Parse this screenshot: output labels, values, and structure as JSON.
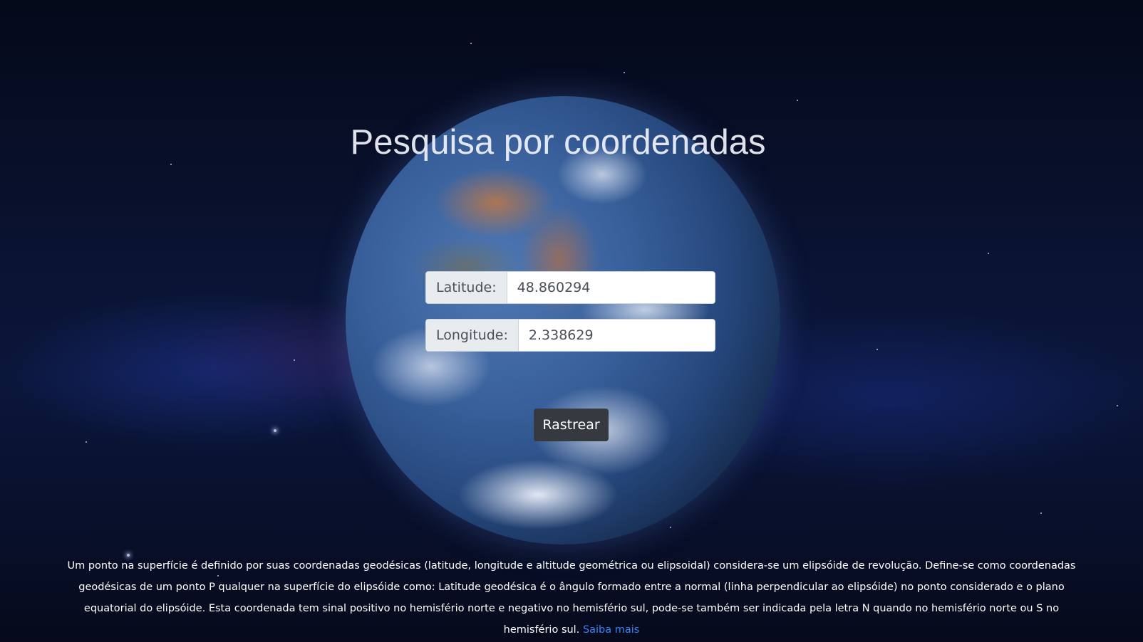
{
  "page": {
    "title": "Pesquisa por coordenadas"
  },
  "form": {
    "latitude": {
      "label": "Latitude:",
      "value": "48.860294"
    },
    "longitude": {
      "label": "Longitude:",
      "value": "2.338629"
    },
    "submit_label": "Rastrear"
  },
  "footer": {
    "description": "Um ponto na superfície é definido por suas coordenadas geodésicas (latitude, longitude e altitude geométrica ou elipsoidal) considera-se um elipsóide de revolução. Define-se como coordenadas geodésicas de um ponto P qualquer na superfície do elipsóide como: Latitude geodésica é o ângulo formado entre a normal (linha perpendicular ao elipsóide) no ponto considerado e o plano equatorial do elipsóide. Esta coordenada tem sinal positivo no hemisfério norte e negativo no hemisfério sul, pode-se também ser indicada pela letra N quando no hemisfério norte ou S no hemisfério sul.",
    "link_label": "Saiba mais"
  },
  "colors": {
    "button_bg": "#343a40",
    "link": "#3b82f6",
    "addon_bg": "#e9ecef"
  }
}
